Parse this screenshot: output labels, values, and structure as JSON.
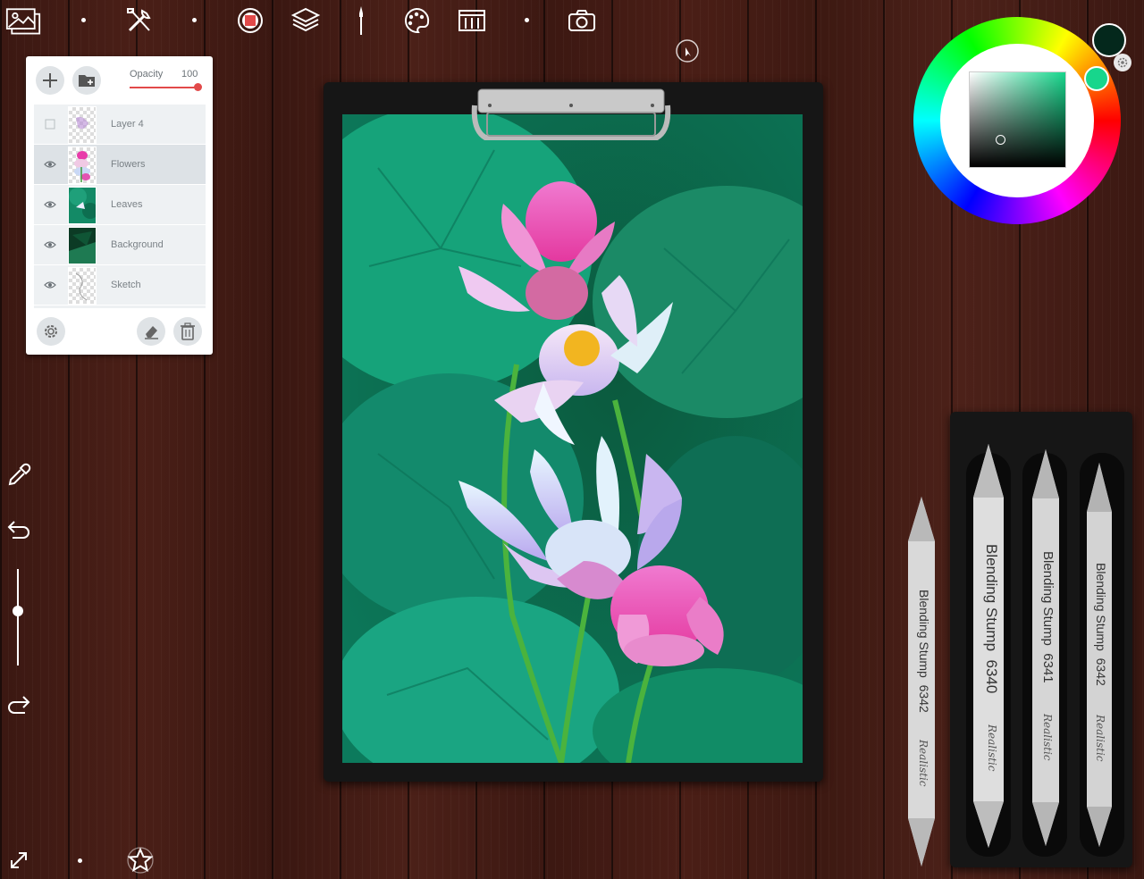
{
  "top_toolbar": {
    "icons": [
      "gallery-icon",
      "tools-icon",
      "record-icon",
      "layers-icon",
      "brush-icon",
      "palette-icon",
      "reference-icon",
      "camera-icon",
      "cursor-icon"
    ]
  },
  "layers_panel": {
    "opacity_label": "Opacity",
    "opacity_value": "100",
    "opacity_fraction": 1.0,
    "layers": [
      {
        "name": "Layer 4",
        "visible": false,
        "selected": false
      },
      {
        "name": "Flowers",
        "visible": true,
        "selected": true
      },
      {
        "name": "Leaves",
        "visible": true,
        "selected": false
      },
      {
        "name": "Background",
        "visible": true,
        "selected": false
      },
      {
        "name": "Sketch",
        "visible": true,
        "selected": false
      }
    ]
  },
  "color_picker": {
    "current_color": "#04281c",
    "hue_color": "#17d68c"
  },
  "stumps": [
    {
      "label": "Blending Stump",
      "number": "6342",
      "brand": "Realistic"
    },
    {
      "label": "Blending Stump",
      "number": "6340",
      "brand": "Realistic"
    },
    {
      "label": "Blending Stump",
      "number": "6341",
      "brand": "Realistic"
    },
    {
      "label": "Blending Stump",
      "number": "6342",
      "brand": "Realistic"
    }
  ],
  "colors": {
    "accent_red": "#e24a4a",
    "wood": "#44201a"
  }
}
